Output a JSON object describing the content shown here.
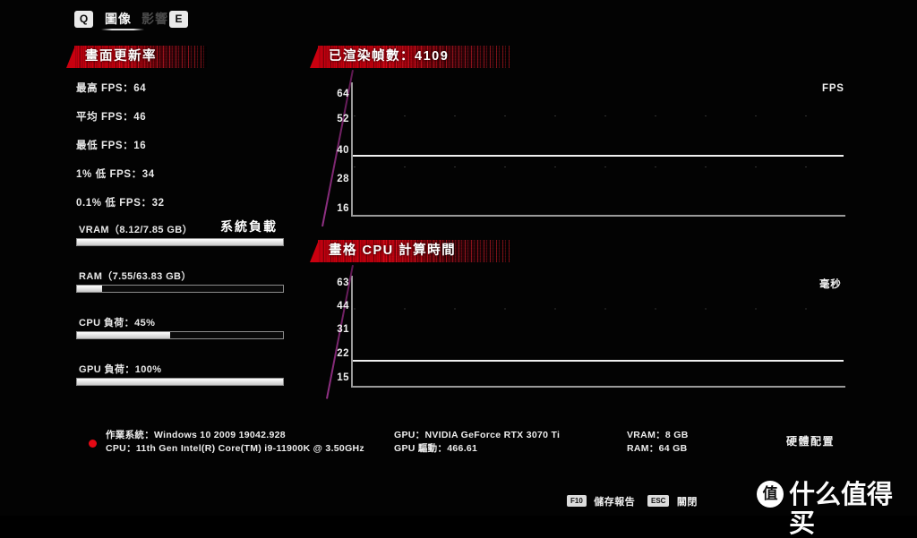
{
  "topbar": {
    "key_prev": "Q",
    "key_next": "E",
    "tab_active": "圖像",
    "tab_inactive": "影響"
  },
  "refresh_rate": {
    "title": "畫面更新率",
    "stats": [
      {
        "label": "最高 FPS：64"
      },
      {
        "label": "平均 FPS：46"
      },
      {
        "label": "最低 FPS：16"
      },
      {
        "label": "1% 低 FPS：34"
      },
      {
        "label": "0.1% 低 FPS：32"
      }
    ]
  },
  "system_load": {
    "title": "系統負載",
    "bars": [
      {
        "label": "VRAM（8.12/7.85 GB）",
        "percent": 100
      },
      {
        "label": "RAM（7.55/63.83 GB）",
        "percent": 12
      },
      {
        "label": "CPU 負荷：45%",
        "percent": 45
      },
      {
        "label": "GPU 負荷：100%",
        "percent": 100
      }
    ]
  },
  "charts": [
    {
      "title": "已渲染幀數：4109",
      "unit": "FPS",
      "yticks": [
        "64",
        "52",
        "40",
        "28",
        "16"
      ],
      "series_level": 38
    },
    {
      "title": "畫格 CPU 計算時間",
      "unit": "毫秒",
      "yticks": [
        "63",
        "44",
        "31",
        "22",
        "15"
      ],
      "series_level": 27
    }
  ],
  "chart_data": [
    {
      "type": "line",
      "title": "已渲染幀數：4109",
      "xlabel": "",
      "ylabel": "FPS",
      "yticks": [
        64,
        52,
        40,
        28,
        16
      ],
      "ylim": [
        16,
        64
      ],
      "grid": true,
      "series": [
        {
          "name": "FPS",
          "constant_value": 38
        }
      ]
    },
    {
      "type": "line",
      "title": "畫格 CPU 計算時間",
      "xlabel": "",
      "ylabel": "毫秒",
      "yticks": [
        63,
        44,
        31,
        22,
        15
      ],
      "ylim": [
        15,
        63
      ],
      "grid": true,
      "series": [
        {
          "name": "毫秒",
          "constant_value": 27
        }
      ]
    }
  ],
  "hardware": {
    "title": "硬體配置",
    "os": "作業系統：Windows 10 2009 19042.928",
    "cpu": "CPU：11th Gen Intel(R) Core(TM) i9-11900K @ 3.50GHz",
    "gpu": "GPU：NVIDIA GeForce RTX 3070 Ti",
    "gpu_driver": "GPU 驅動：466.61",
    "vram": "VRAM：8 GB",
    "ram": "RAM：64 GB"
  },
  "actions": {
    "save_key": "F10",
    "save_label": "儲存報告",
    "close_key": "ESC",
    "close_label": "關閉"
  },
  "watermark": {
    "logo": "值",
    "text": "什么值得买"
  }
}
